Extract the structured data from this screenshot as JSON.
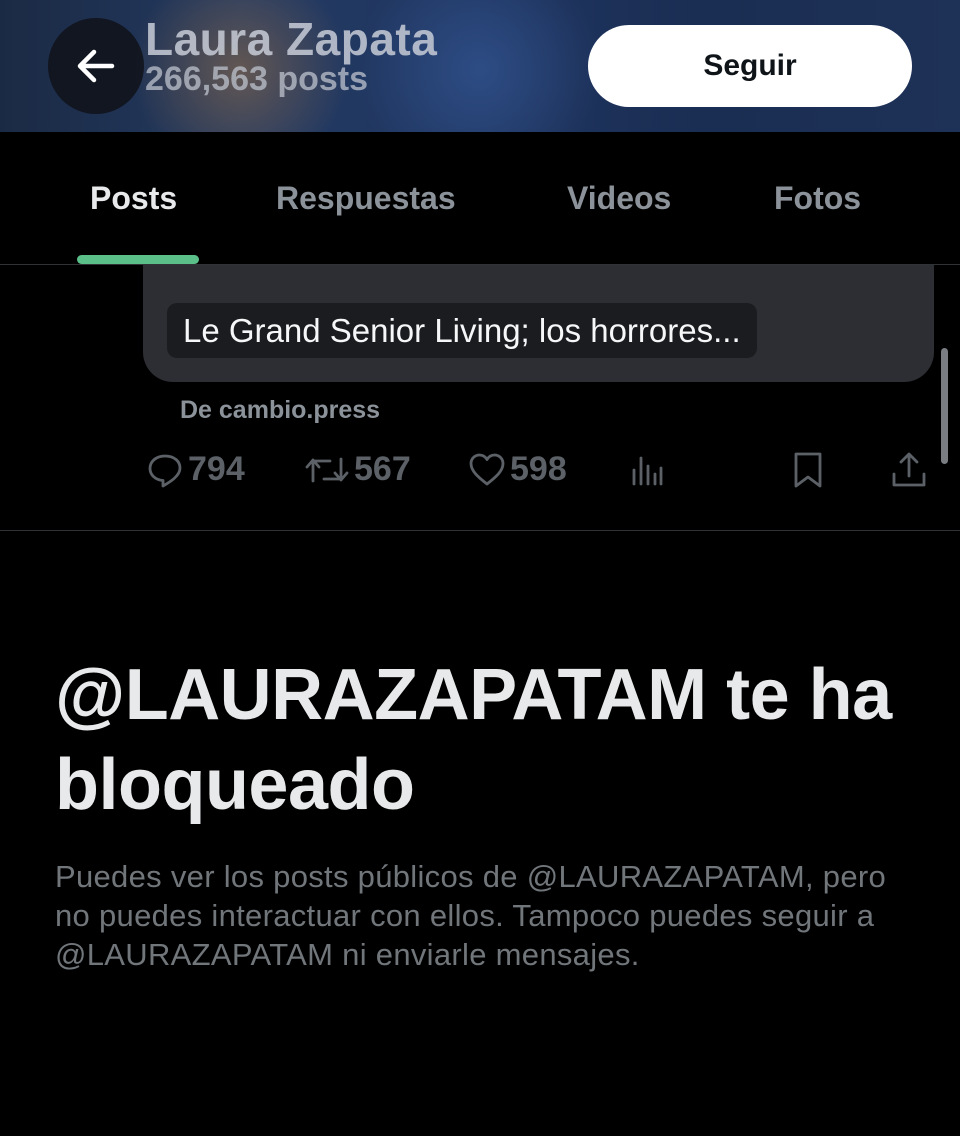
{
  "header": {
    "name": "Laura Zapata",
    "post_count": "266,563 posts",
    "follow_label": "Seguir",
    "back_icon": "arrow-left-icon"
  },
  "tabs": [
    {
      "label": "Posts",
      "active": true
    },
    {
      "label": "Respuestas",
      "active": false
    },
    {
      "label": "Videos",
      "active": false
    },
    {
      "label": "Fotos",
      "active": false
    }
  ],
  "accent_color": "#5bbf8a",
  "post": {
    "link_title": "Le Grand Senior Living; los horrores...",
    "source": "De cambio.press",
    "replies": "794",
    "reposts": "567",
    "likes": "598"
  },
  "blocked": {
    "title": "@LAURAZAPATAM te ha bloqueado",
    "description": "Puedes ver los posts públicos de @LAURAZAPATAM, pero no puedes interactuar con ellos. Tampoco puedes seguir a @LAURAZAPATAM ni enviarle mensajes."
  }
}
